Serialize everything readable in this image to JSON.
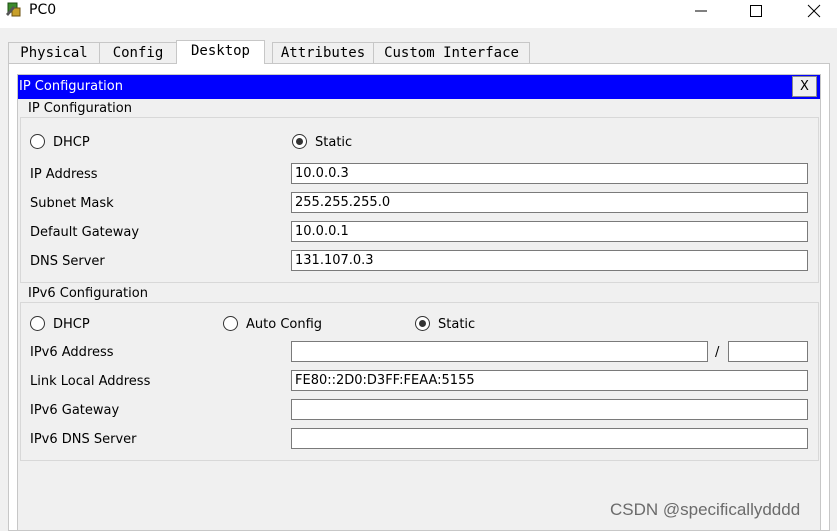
{
  "window": {
    "title": "PC0",
    "icon": "packet-tracer-pc-icon",
    "controls": [
      "minimize-icon",
      "maximize-icon",
      "close-icon"
    ]
  },
  "tabs": [
    {
      "label": "Physical",
      "active": false
    },
    {
      "label": "Config",
      "active": false
    },
    {
      "label": "Desktop",
      "active": true
    },
    {
      "label": "Attributes",
      "active": false
    },
    {
      "label": "Custom Interface",
      "active": false
    }
  ],
  "ip_window": {
    "title": "IP Configuration",
    "close_label": "X"
  },
  "ipv4": {
    "group_title": "IP Configuration",
    "dhcp_label": "DHCP",
    "static_label": "Static",
    "selected_mode": "Static",
    "fields": [
      {
        "label": "IP Address",
        "value": "10.0.0.3"
      },
      {
        "label": "Subnet Mask",
        "value": "255.255.255.0"
      },
      {
        "label": "Default Gateway",
        "value": "10.0.0.1"
      },
      {
        "label": "DNS Server",
        "value": "131.107.0.3"
      }
    ]
  },
  "ipv6": {
    "group_title": "IPv6 Configuration",
    "dhcp_label": "DHCP",
    "auto_label": "Auto Config",
    "static_label": "Static",
    "selected_mode": "Static",
    "address_label": "IPv6 Address",
    "address_value": "",
    "prefix_separator": "/",
    "prefix_value": "",
    "link_local_label": "Link Local Address",
    "link_local_value": "FE80::2D0:D3FF:FEAA:5155",
    "gateway_label": "IPv6 Gateway",
    "gateway_value": "",
    "dns_label": "IPv6 DNS Server",
    "dns_value": ""
  },
  "watermark": "CSDN @specificallydddd",
  "colors": {
    "header_blue": "#0000ff",
    "panel_gray": "#f0f0f0"
  }
}
